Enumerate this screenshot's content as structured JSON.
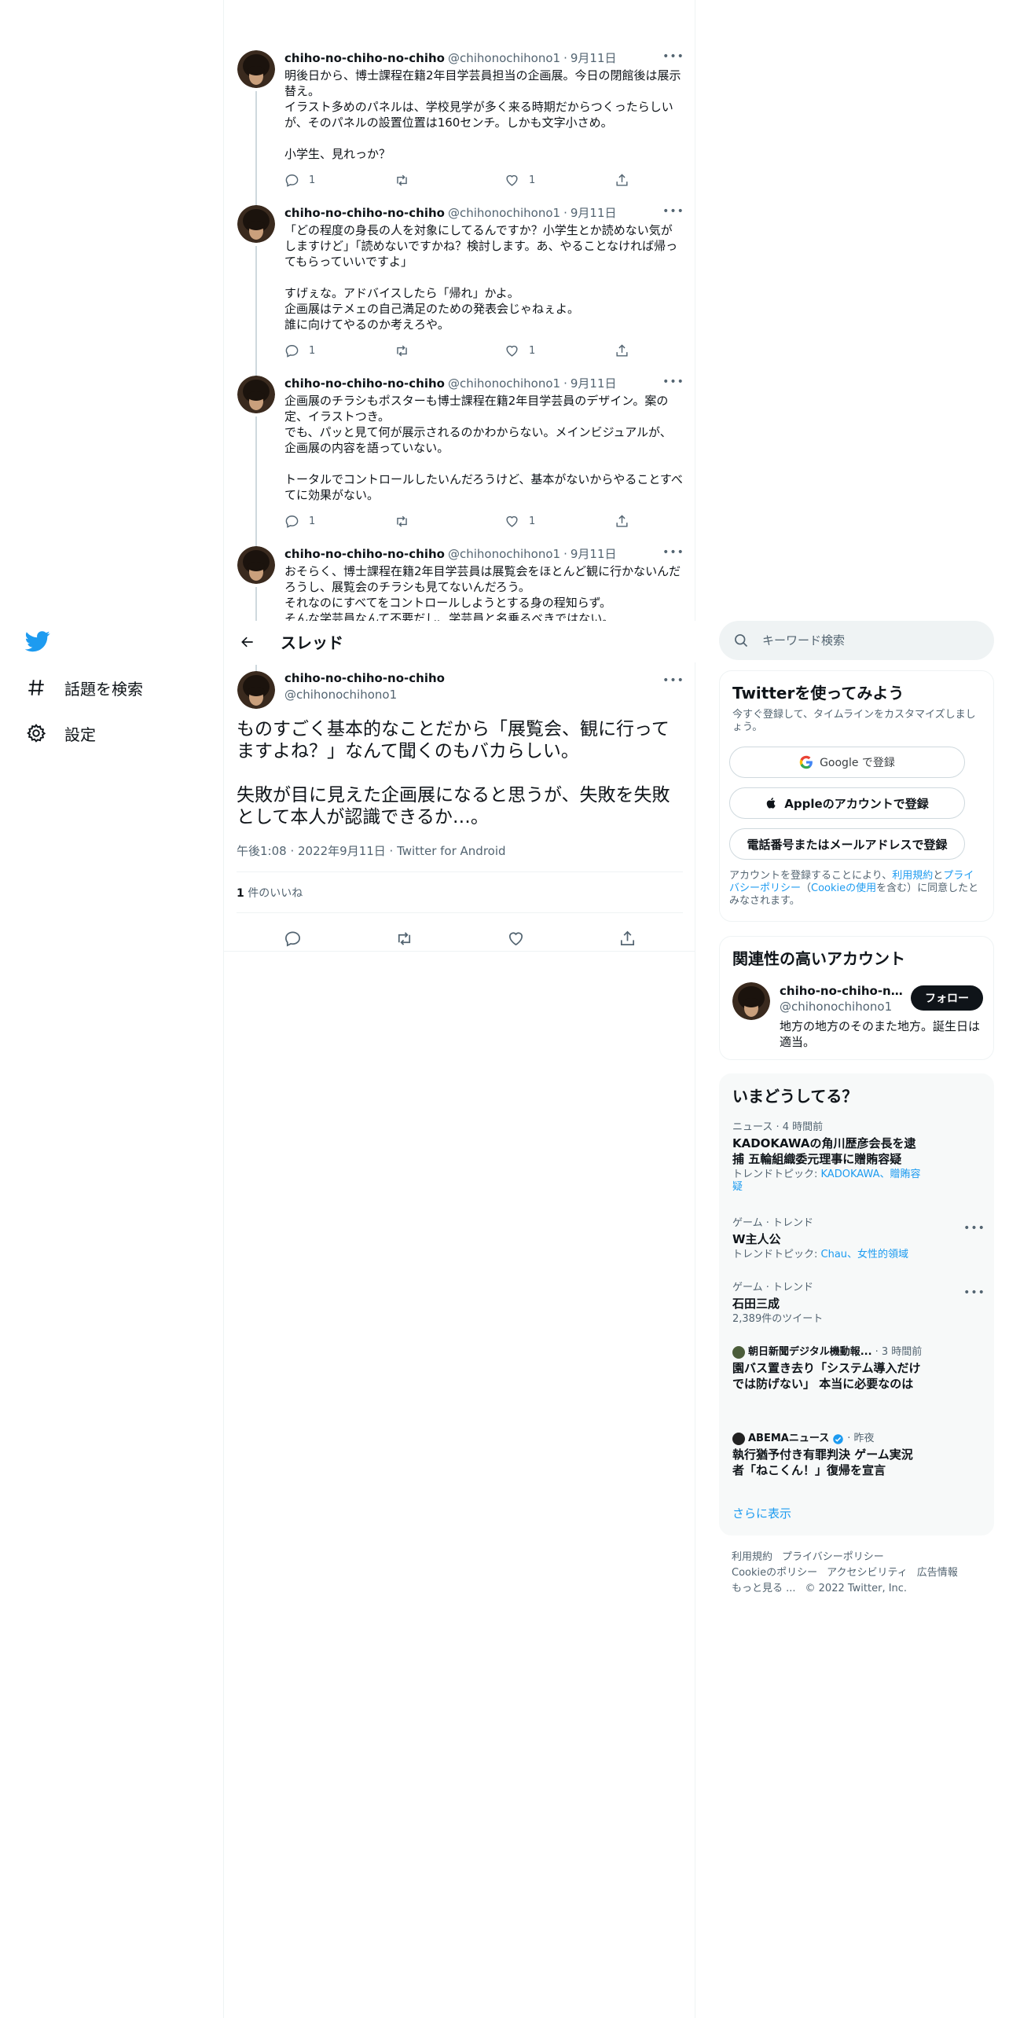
{
  "nav": {
    "explore_label": "話題を検索",
    "settings_label": "設定"
  },
  "header": {
    "title": "スレッド"
  },
  "thread": [
    {
      "name": "chiho-no-chiho-no-chiho",
      "handle": "@chihonochihono1",
      "dot": "·",
      "date": "9月11日",
      "text": "明後日から、博士課程在籍2年目学芸員担当の企画展。今日の閉館後は展示替え。\nイラスト多めのパネルは、学校見学が多く来る時期だからつくったらしいが、そのパネルの設置位置は160センチ。しかも文字小さめ。\n\n小学生、見れっか？",
      "replies": "1",
      "likes": "1"
    },
    {
      "name": "chiho-no-chiho-no-chiho",
      "handle": "@chihonochihono1",
      "dot": "·",
      "date": "9月11日",
      "text": "「どの程度の身長の人を対象にしてるんですか？小学生とか読めない気がしますけど」「読めないですかね？検討します。あ、やることなければ帰ってもらっていいですよ」\n\nすげぇな。アドバイスしたら「帰れ」かよ。\n企画展はテメェの自己満足のための発表会じゃねぇよ。\n誰に向けてやるのか考えろや。",
      "replies": "1",
      "likes": "1"
    },
    {
      "name": "chiho-no-chiho-no-chiho",
      "handle": "@chihonochihono1",
      "dot": "·",
      "date": "9月11日",
      "text": "企画展のチラシもポスターも博士課程在籍2年目学芸員のデザイン。案の定、イラストつき。\nでも、パッと見て何が展示されるのかわからない。メインビジュアルが、企画展の内容を語っていない。\n\nトータルでコントロールしたいんだろうけど、基本がないからやることすべてに効果がない。",
      "replies": "1",
      "likes": "1"
    },
    {
      "name": "chiho-no-chiho-no-chiho",
      "handle": "@chihonochihono1",
      "dot": "·",
      "date": "9月11日",
      "text": "おそらく、博士課程在籍2年目学芸員は展覧会をほとんど観に行かないんだろうし、展覧会のチラシも見てないんだろう。\nそれなのにすべてをコントロールしようとする身の程知らず。\nそんな学芸員なんて不要だし、学芸員と名乗るべきではない。"
    }
  ],
  "focus": {
    "name": "chiho-no-chiho-no-chiho",
    "handle": "@chihonochihono1",
    "text": "ものすごく基本的なことだから「展覧会、観に行ってますよね？」なんて聞くのもバカらしい。\n\n失敗が目に見えた企画展になると思うが、失敗を失敗として本人が認識できるか…。",
    "meta": "午後1:08 · 2022年9月11日 · Twitter for Android",
    "likes_count": "1",
    "likes_label": " 件のいいね"
  },
  "search": {
    "placeholder": "キーワード検索"
  },
  "signup": {
    "title": "Twitterを使ってみよう",
    "subtitle": "今すぐ登録して、タイムラインをカスタマイズしましょう。",
    "google_label": "Google で登録",
    "apple_label": "Appleのアカウントで登録",
    "phone_label": "電話番号またはメールアドレスで登録",
    "legal_prefix": "アカウントを登録することにより、",
    "legal_link1": "利用規約",
    "legal_mid1": "と",
    "legal_link2": "プライバシーポリシー",
    "legal_mid2": "（",
    "legal_link3": "Cookieの使用",
    "legal_suffix": "を含む）に同意したとみなされます。"
  },
  "related": {
    "title": "関連性の高いアカウント",
    "name": "chiho-no-chiho-no-chiho",
    "handle": "@chihonochihono1",
    "bio": "地方の地方のそのまた地方。誕生日は適当。",
    "follow_label": "フォロー"
  },
  "trends": {
    "title": "いまどうしてる？",
    "items": [
      {
        "meta": "ニュース · 4 時間前",
        "title": "KADOKAWAの角川歴彦会長を逮捕 五輪組織委元理事に贈賄容疑",
        "sub_prefix": "トレンドトピック: ",
        "sub_link": "KADOKAWA、贈賄容疑"
      },
      {
        "meta": "ゲーム · トレンド",
        "title": "W主人公",
        "sub_prefix": "トレンドトピック: ",
        "sub_link": "Chau、女性的領域"
      },
      {
        "meta": "ゲーム · トレンド",
        "title": "石田三成",
        "sub": "2,389件のツイート"
      },
      {
        "source": "朝日新聞デジタル機動報...",
        "time": "· 3 時間前",
        "title": "園バス置き去り「システム導入だけでは防げない」 本当に必要なのは"
      },
      {
        "source": "ABEMAニュース",
        "time": "· 昨夜",
        "title": "執行猶予付き有罪判決 ゲーム実況者「ねこくん！」復帰を宣言"
      }
    ],
    "show_more": "さらに表示"
  },
  "footer": {
    "terms": "利用規約",
    "privacy": "プライバシーポリシー",
    "cookie": "Cookieのポリシー",
    "accessibility": "アクセシビリティ",
    "ads": "広告情報",
    "more": "もっと見る ...",
    "copyright": "© 2022 Twitter, Inc."
  },
  "colors": {
    "accent": "#1d9bf0",
    "text": "#0f1419",
    "secondary": "#536471",
    "follow_bg": "#0f1419"
  }
}
